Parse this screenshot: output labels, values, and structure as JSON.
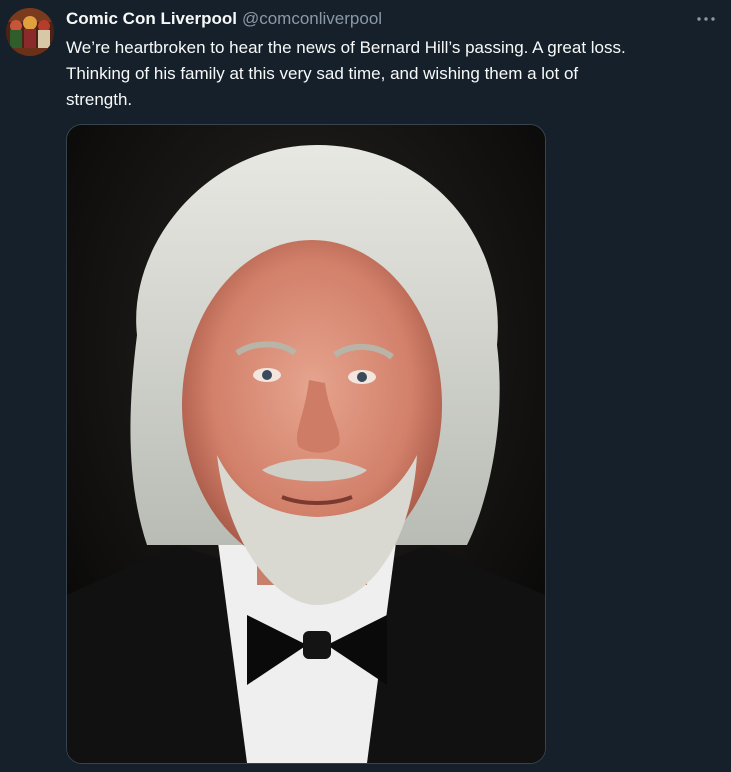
{
  "author": {
    "display_name": "Comic Con Liverpool",
    "handle": "@comconliverpool",
    "avatar_icon": "avatar-image"
  },
  "more_icon": "more-options-icon",
  "tweet": {
    "lines": [
      "We’re heartbroken to hear the news of Bernard Hill’s passing. A great loss.",
      "Thinking of his family at this very sad time, and wishing them a lot of",
      "strength."
    ]
  },
  "media": {
    "type": "photo"
  },
  "colors": {
    "background": "#15202b",
    "text_primary": "#f7f9f9",
    "text_secondary": "#8b98a5",
    "border": "#38444d"
  }
}
